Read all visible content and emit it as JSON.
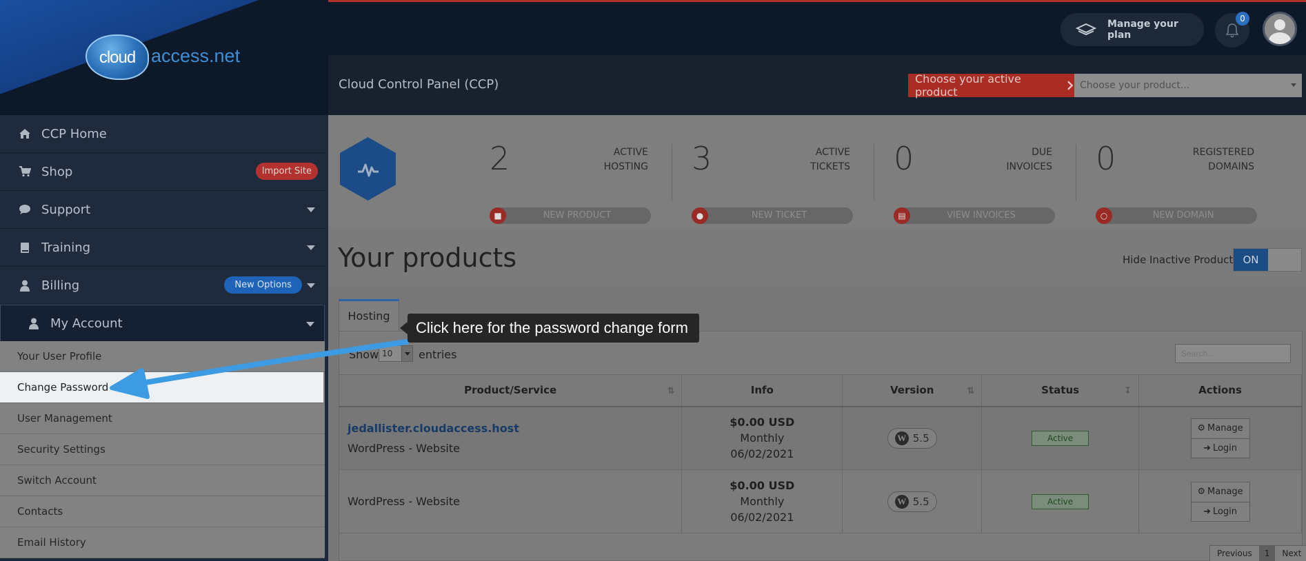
{
  "brand": {
    "logo_word": "cloud",
    "logo_domain": "access.net"
  },
  "topbar": {
    "manage_plan": "Manage your plan",
    "notification_count": "0"
  },
  "panel": {
    "title": "Cloud Control Panel (CCP)",
    "choose_label": "Choose your active product",
    "choose_placeholder": "Choose your product..."
  },
  "sidebar": {
    "items": [
      {
        "label": "CCP Home",
        "icon": "home-icon"
      },
      {
        "label": "Shop",
        "icon": "cart-icon",
        "badge": "Import Site"
      },
      {
        "label": "Support",
        "icon": "chat-icon"
      },
      {
        "label": "Training",
        "icon": "book-icon"
      },
      {
        "label": "Billing",
        "icon": "user-icon",
        "badge": "New Options"
      },
      {
        "label": "My Account",
        "icon": "user-icon"
      }
    ],
    "subitems": [
      "Your User Profile",
      "Change Password",
      "User Management",
      "Security Settings",
      "Switch Account",
      "Contacts",
      "Email History"
    ]
  },
  "stats": [
    {
      "value": "2",
      "label_line1": "ACTIVE",
      "label_line2": "HOSTING",
      "action": "NEW PRODUCT"
    },
    {
      "value": "3",
      "label_line1": "ACTIVE",
      "label_line2": "TICKETS",
      "action": "NEW TICKET"
    },
    {
      "value": "0",
      "label_line1": "DUE",
      "label_line2": "INVOICES",
      "action": "VIEW INVOICES"
    },
    {
      "value": "0",
      "label_line1": "REGISTERED",
      "label_line2": "DOMAINS",
      "action": "NEW DOMAIN"
    }
  ],
  "products": {
    "title": "Your products",
    "hide_inactive_label": "Hide Inactive Products",
    "toggle_state": "ON",
    "tab": "Hosting",
    "show_label": "Show",
    "show_value": "10",
    "entries_label": "entries",
    "search_placeholder": "Search...",
    "columns": [
      "Product/Service",
      "Info",
      "Version",
      "Status",
      "Actions"
    ],
    "rows": [
      {
        "link": "jedallister.cloudaccess.host",
        "type": "WordPress - Website",
        "price": "$0.00 USD",
        "cycle": "Monthly",
        "date": "06/02/2021",
        "version": "5.5",
        "status": "Active",
        "manage": "Manage",
        "login": "Login"
      },
      {
        "link": "",
        "type": "WordPress - Website",
        "price": "$0.00 USD",
        "cycle": "Monthly",
        "date": "06/02/2021",
        "version": "5.5",
        "status": "Active",
        "manage": "Manage",
        "login": "Login"
      }
    ],
    "pager": {
      "prev": "Previous",
      "page": "1",
      "next": "Next"
    }
  },
  "annotation": {
    "text": "Click here for the password change form",
    "color": "#3d9be3"
  }
}
